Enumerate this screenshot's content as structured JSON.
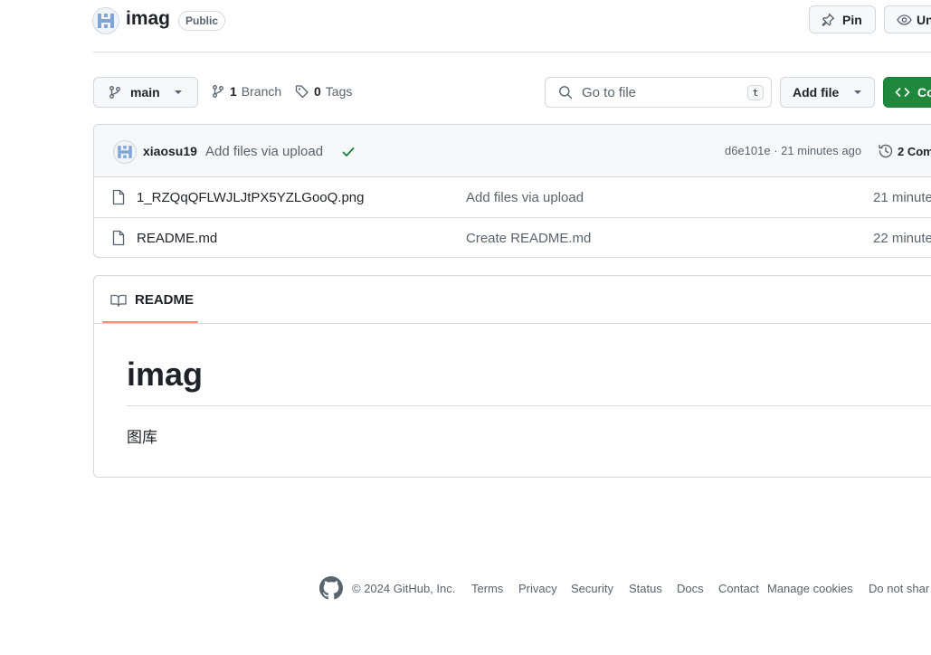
{
  "repo": {
    "name": "imag",
    "visibility": "Public"
  },
  "header_actions": {
    "pin_label": "Pin",
    "watch_label": "Un"
  },
  "branch_bar": {
    "branch_name": "main",
    "branch_count": "1",
    "branch_label": "Branch",
    "tag_count": "0",
    "tag_label": "Tags",
    "search_placeholder": "Go to file",
    "search_shortcut": "t",
    "add_file_label": "Add file",
    "code_label": "Co"
  },
  "latest_commit": {
    "author": "xiaosu19",
    "message": "Add files via upload",
    "sha_time": "d6e101e · 21 minutes ago",
    "commits_label": "2 Com"
  },
  "files": [
    {
      "name": "1_RZQqQFLWJLJtPX5YZLGooQ.png",
      "message": "Add files via upload",
      "time": "21 minute"
    },
    {
      "name": "README.md",
      "message": "Create README.md",
      "time": "22 minute"
    }
  ],
  "readme": {
    "tab_label": "README",
    "title": "imag",
    "body": "图库"
  },
  "footer": {
    "copyright": "© 2024 GitHub, Inc.",
    "links": [
      "Terms",
      "Privacy",
      "Security",
      "Status",
      "Docs",
      "Contact",
      "Manage cookies",
      "Do not shar"
    ]
  },
  "colors": {
    "accent_green": "#1f883d",
    "tab_underline": "#fd8c73",
    "check_green": "#1a7f37",
    "muted_text": "#59636e"
  },
  "icons": [
    "identicon-avatar",
    "pin-icon",
    "eye-icon",
    "git-branch-icon",
    "chevron-down-icon",
    "tag-icon",
    "search-icon",
    "code-icon",
    "check-icon",
    "history-icon",
    "file-icon",
    "book-icon",
    "github-mark-icon"
  ]
}
